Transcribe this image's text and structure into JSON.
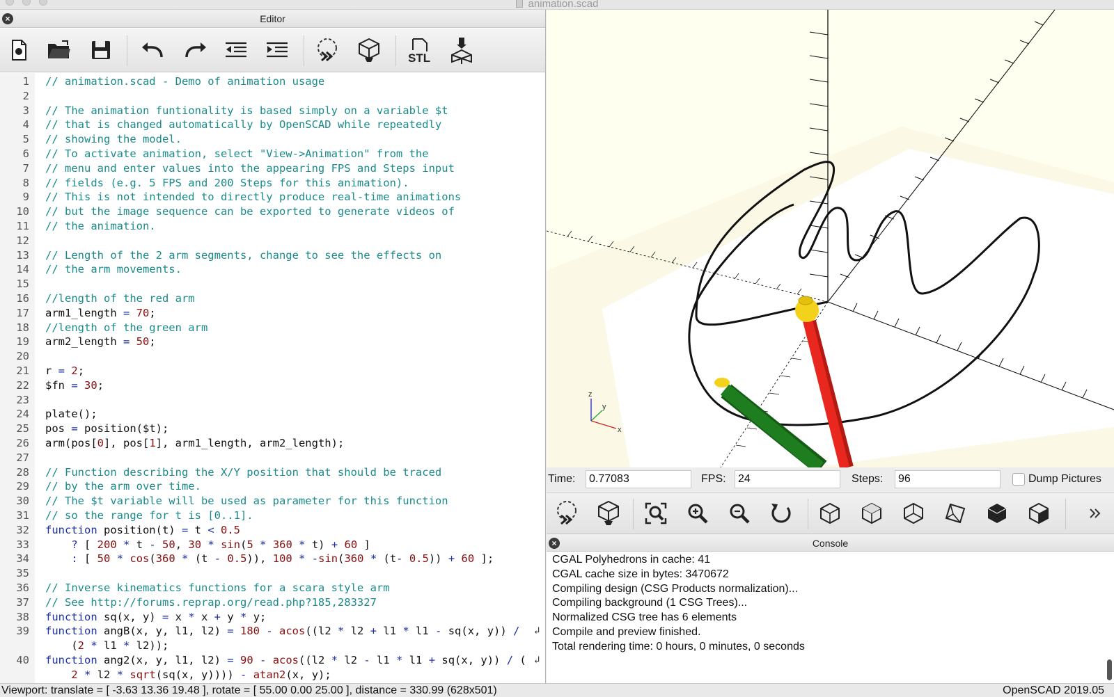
{
  "window": {
    "title": "animation.scad"
  },
  "editor": {
    "title": "Editor",
    "toolbar": [
      {
        "name": "new-file-icon"
      },
      {
        "name": "open-file-icon"
      },
      {
        "name": "save-icon"
      },
      {
        "name": "undo-icon"
      },
      {
        "name": "redo-icon"
      },
      {
        "name": "unindent-icon"
      },
      {
        "name": "indent-icon"
      },
      {
        "name": "preview-icon"
      },
      {
        "name": "render-icon"
      },
      {
        "name": "export-stl-icon",
        "label": "STL"
      },
      {
        "name": "send-to-printer-icon"
      }
    ],
    "lines": [
      {
        "n": "1",
        "text": "// animation.scad - Demo of animation usage"
      },
      {
        "n": "2",
        "text": ""
      },
      {
        "n": "3",
        "text": "// The animation funtionality is based simply on a variable $t"
      },
      {
        "n": "4",
        "text": "// that is changed automatically by OpenSCAD while repeatedly"
      },
      {
        "n": "5",
        "text": "// showing the model."
      },
      {
        "n": "6",
        "text": "// To activate animation, select \"View->Animation\" from the"
      },
      {
        "n": "7",
        "text": "// menu and enter values into the appearing FPS and Steps input"
      },
      {
        "n": "8",
        "text": "// fields (e.g. 5 FPS and 200 Steps for this animation)."
      },
      {
        "n": "9",
        "text": "// This is not intended to directly produce real-time animations"
      },
      {
        "n": "10",
        "text": "// but the image sequence can be exported to generate videos of"
      },
      {
        "n": "11",
        "text": "// the animation."
      },
      {
        "n": "12",
        "text": ""
      },
      {
        "n": "13",
        "text": "// Length of the 2 arm segments, change to see the effects on"
      },
      {
        "n": "14",
        "text": "// the arm movements."
      },
      {
        "n": "15",
        "text": ""
      },
      {
        "n": "16",
        "text": "//length of the red arm"
      },
      {
        "n": "17",
        "text": "arm1_length = 70;"
      },
      {
        "n": "18",
        "text": "//length of the green arm"
      },
      {
        "n": "19",
        "text": "arm2_length = 50;"
      },
      {
        "n": "20",
        "text": ""
      },
      {
        "n": "21",
        "text": "r = 2;"
      },
      {
        "n": "22",
        "text": "$fn = 30;"
      },
      {
        "n": "23",
        "text": ""
      },
      {
        "n": "24",
        "text": "plate();"
      },
      {
        "n": "25",
        "text": "pos = position($t);"
      },
      {
        "n": "26",
        "text": "arm(pos[0], pos[1], arm1_length, arm2_length);"
      },
      {
        "n": "27",
        "text": ""
      },
      {
        "n": "28",
        "text": "// Function describing the X/Y position that should be traced"
      },
      {
        "n": "29",
        "text": "// by the arm over time."
      },
      {
        "n": "30",
        "text": "// The $t variable will be used as parameter for this function"
      },
      {
        "n": "31",
        "text": "// so the range for t is [0..1]."
      },
      {
        "n": "32",
        "text": "function position(t) = t < 0.5"
      },
      {
        "n": "33",
        "text": "    ? [ 200 * t - 50, 30 * sin(5 * 360 * t) + 60 ]"
      },
      {
        "n": "34",
        "text": "    : [ 50 * cos(360 * (t - 0.5)), 100 * -sin(360 * (t- 0.5)) + 60 ];"
      },
      {
        "n": "35",
        "text": ""
      },
      {
        "n": "36",
        "text": "// Inverse kinematics functions for a scara style arm"
      },
      {
        "n": "37",
        "text": "// See http://forums.reprap.org/read.php?185,283327"
      },
      {
        "n": "38",
        "text": "function sq(x, y) = x * x + y * y;"
      },
      {
        "n": "39",
        "text": "function angB(x, y, l1, l2) = 180 - acos((l2 * l2 + l1 * l1 - sq(x, y)) /",
        "wrap": true
      },
      {
        "n": "",
        "text": "    (2 * l1 * l2));"
      },
      {
        "n": "40",
        "text": "function ang2(x, y, l1, l2) = 90 - acos((l2 * l2 - l1 * l1 + sq(x, y)) / (",
        "wrap": true
      },
      {
        "n": "",
        "text": "    2 * l2 * sqrt(sq(x, y)))) - atan2(x, y);"
      }
    ]
  },
  "animation": {
    "time_label": "Time:",
    "time_value": "0.77083",
    "fps_label": "FPS:",
    "fps_value": "24",
    "steps_label": "Steps:",
    "steps_value": "96",
    "dump_label": "Dump Pictures"
  },
  "view_toolbar": [
    "preview-icon",
    "render-icon",
    "view-all-icon",
    "zoom-in-icon",
    "zoom-out-icon",
    "reset-view-icon",
    "view-right-icon",
    "view-top-icon",
    "view-bottom-icon",
    "view-left-icon",
    "view-front-icon",
    "view-back-icon",
    "more-icon"
  ],
  "console": {
    "title": "Console",
    "lines": [
      "CGAL Polyhedrons in cache: 41",
      "CGAL cache size in bytes: 3470672",
      "Compiling design (CSG Products normalization)...",
      "Compiling background (1 CSG Trees)...",
      "Normalized CSG tree has 6 elements",
      "Compile and preview finished.",
      "Total rendering time: 0 hours, 0 minutes, 0 seconds"
    ]
  },
  "status": {
    "viewport": "Viewport: translate = [ -3.63 13.36 19.48 ], rotate = [ 55.00 0.00 25.00 ], distance = 330.99 (628x501)",
    "version": "OpenSCAD 2019.05"
  },
  "axes": {
    "x": "x",
    "y": "y",
    "z": "z"
  },
  "colors": {
    "comment": "#1a8a8a",
    "keyword": "#1b2fa8",
    "number": "#8a0f0f",
    "arm1": "#e8281e",
    "arm2": "#1e7d1e",
    "joint": "#f2d21a",
    "viewport_bg": "#fffff0"
  }
}
